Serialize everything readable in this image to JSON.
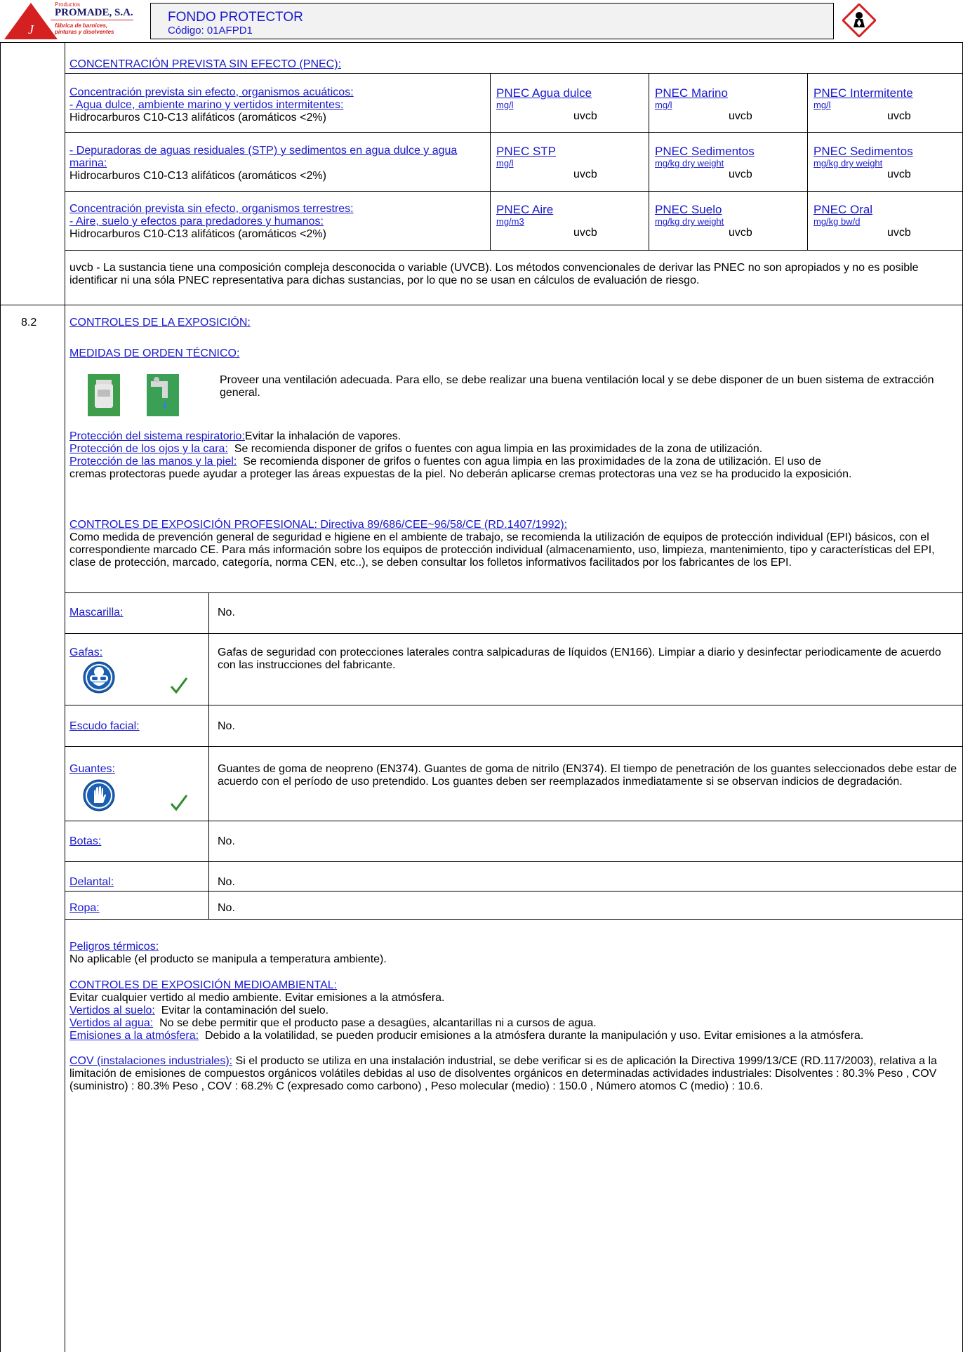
{
  "header": {
    "company_small": "Productos",
    "company_name": "PROMADE, S.A.",
    "company_tagline_1": "fábrica de barnices,",
    "company_tagline_2": "pinturas y disolventes",
    "product_name": "FONDO PROTECTOR",
    "product_code": "Código: 01AFPD1"
  },
  "pnec": {
    "title": "CONCENTRACIÓN PREVISTA SIN EFECTO (PNEC):",
    "rows": [
      {
        "heading": "Concentración prevista sin efecto, organismos acuáticos:",
        "sub": "- Agua dulce, ambiente marino y vertidos intermitentes:",
        "substance": "Hidrocarburos C10-C13 alifáticos (aromáticos <2%)",
        "cells": [
          {
            "label": "PNEC Agua dulce",
            "unit": "mg/l",
            "value": "uvcb"
          },
          {
            "label": "PNEC Marino",
            "unit": "mg/l",
            "value": "uvcb"
          },
          {
            "label": "PNEC Intermitente",
            "unit": "mg/l",
            "value": "uvcb"
          }
        ]
      },
      {
        "heading": "",
        "sub": "- Depuradoras de aguas residuales (STP) y sedimentos en agua dulce y agua marina:",
        "substance": "Hidrocarburos C10-C13 alifáticos (aromáticos <2%)",
        "cells": [
          {
            "label": "PNEC STP",
            "unit": "mg/l",
            "value": "uvcb"
          },
          {
            "label": "PNEC Sedimentos",
            "unit": "mg/kg dry weight",
            "value": "uvcb"
          },
          {
            "label": "PNEC Sedimentos",
            "unit": "mg/kg dry weight",
            "value": "uvcb"
          }
        ]
      },
      {
        "heading": "Concentración prevista sin efecto, organismos terrestres:",
        "sub": "- Aire, suelo y efectos para predadores y humanos:",
        "substance": "Hidrocarburos C10-C13 alifáticos (aromáticos <2%)",
        "cells": [
          {
            "label": "PNEC Aire",
            "unit": "mg/m3",
            "value": "uvcb"
          },
          {
            "label": "PNEC Suelo",
            "unit": "mg/kg dry weight",
            "value": "uvcb"
          },
          {
            "label": "PNEC Oral",
            "unit": "mg/kg bw/d",
            "value": "uvcb"
          }
        ]
      }
    ],
    "note": "uvcb - La sustancia tiene una composición compleja desconocida o variable (UVCB). Los métodos convencionales de derivar las PNEC no son apropiados y no es posible identificar ni una sóla PNEC representativa para dichas sustancias, por lo que no se usan en cálculos de evaluación de riesgo."
  },
  "section82": {
    "number": "8.2",
    "title": "CONTROLES DE LA EXPOSICIÓN:",
    "tech_title": "MEDIDAS DE ORDEN TÉCNICO:",
    "tech_text": "Proveer una ventilación adecuada. Para ello, se debe realizar una buena ventilación local y se debe disponer de un buen sistema de extracción general.",
    "resp_label": "Protección del sistema respiratorio:",
    "resp_text": "Evitar la inhalación de vapores.",
    "eyes_label": "Protección de los ojos y la cara:",
    "eyes_text": "Se recomienda disponer de grifos o fuentes con agua limpia en las proximidades de la zona de utilización.",
    "hands_label": "Protección de las manos y la piel:",
    "hands_text_1": "Se recomienda disponer de grifos o fuentes con agua limpia en las proximidades de la zona de utilización. El uso de",
    "hands_text_2": "cremas protectoras puede ayudar a proteger las áreas expuestas de la piel. No deberán aplicarse cremas protectoras una vez se ha producido la exposición.",
    "prof_title": "CONTROLES DE EXPOSICIÓN PROFESIONAL: Directiva 89/686/CEE~96/58/CE (RD.1407/1992):",
    "prof_text": "Como medida de prevención general de seguridad e higiene en el ambiente de trabajo, se recomienda la utilización de equipos de protección individual (EPI) básicos, con el correspondiente marcado CE. Para más información sobre los equipos de protección individual (almacenamiento, uso, limpieza, mantenimiento, tipo y características del EPI, clase de protección, marcado, categoría, norma CEN, etc..), se deben consultar los folletos informativos facilitados por los fabricantes de los EPI."
  },
  "epi": [
    {
      "label": "Mascarilla:",
      "text": "No."
    },
    {
      "label": "Gafas:",
      "text": "Gafas de seguridad con protecciones laterales contra salpicaduras de líquidos (EN166). Limpiar a diario y desinfectar periodicamente de acuerdo con las instrucciones del fabricante."
    },
    {
      "label": "Escudo facial:",
      "text": "No."
    },
    {
      "label": "Guantes:",
      "text": "Guantes de goma de neopreno (EN374). Guantes de goma de nitrilo (EN374). El tiempo de penetración de los guantes seleccionados debe estar de acuerdo con el período de uso pretendido. Los guantes deben ser reemplazados inmediatamente si se observan indicios de degradación."
    },
    {
      "label": "Botas:",
      "text": "No."
    },
    {
      "label": "Delantal:",
      "text": "No."
    },
    {
      "label": "Ropa:",
      "text": "No."
    }
  ],
  "thermal": {
    "label": "Peligros térmicos:",
    "text": "No aplicable (el producto se manipula a temperatura ambiente)."
  },
  "env": {
    "title": "CONTROLES DE EXPOSICIÓN MEDIOAMBIENTAL:",
    "text": "Evitar cualquier vertido al medio ambiente. Evitar emisiones a la atmósfera.",
    "soil_label": "Vertidos al suelo:",
    "soil_text": "Evitar la contaminación del suelo.",
    "water_label": "Vertidos al agua:",
    "water_text": "No se debe permitir que el producto pase a desagües, alcantarillas ni a cursos de agua.",
    "air_label": "Emisiones a la atmósfera:",
    "air_text": "Debido a la volatilidad, se pueden producir emisiones a la atmósfera durante la manipulación y uso. Evitar emisiones a la atmósfera.",
    "cov_label": "COV (instalaciones industriales):",
    "cov_text": "Si el producto se utiliza en una instalación industrial, se debe verificar si es de aplicación la Directiva 1999/13/CE (RD.117/2003), relativa a la limitación de emisiones de compuestos orgánicos volátiles debidas al uso de disolventes orgánicos en determinadas actividades industriales: Disolventes : 80.3% Peso , COV (suministro) : 80.3% Peso , COV : 68.2% C (expresado como carbono) , Peso molecular (medio) : 150.0 , Número atomos C (medio) : 10.6."
  },
  "colors": {
    "link": "#1a1acc",
    "logo_red": "#d42020",
    "check_green": "#2e8b2e",
    "ppe_blue": "#1a5fb4",
    "header_bg": "#f2f2f2"
  }
}
